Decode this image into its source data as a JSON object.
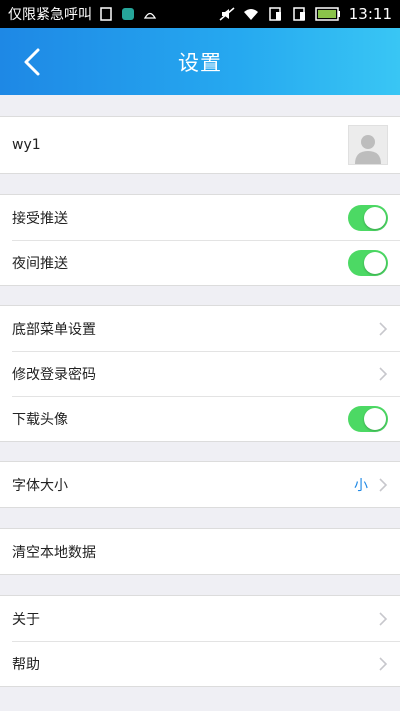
{
  "status_bar": {
    "carrier": "仅限紧急呼叫",
    "time": "13:11"
  },
  "header": {
    "title": "设置"
  },
  "account": {
    "username": "wy1"
  },
  "notifications": {
    "push_label": "接受推送",
    "push_on": true,
    "night_push_label": "夜间推送",
    "night_push_on": true
  },
  "general": {
    "bottom_menu_label": "底部菜单设置",
    "change_password_label": "修改登录密码",
    "download_avatar_label": "下载头像",
    "download_avatar_on": true
  },
  "display": {
    "font_size_label": "字体大小",
    "font_size_value": "小"
  },
  "storage": {
    "clear_data_label": "清空本地数据"
  },
  "info": {
    "about_label": "关于",
    "help_label": "帮助"
  },
  "colors": {
    "header_start": "#1e88e5",
    "header_end": "#39c6f4",
    "switch_on": "#4cd964",
    "accent": "#1e88e5",
    "background": "#efeff4"
  }
}
